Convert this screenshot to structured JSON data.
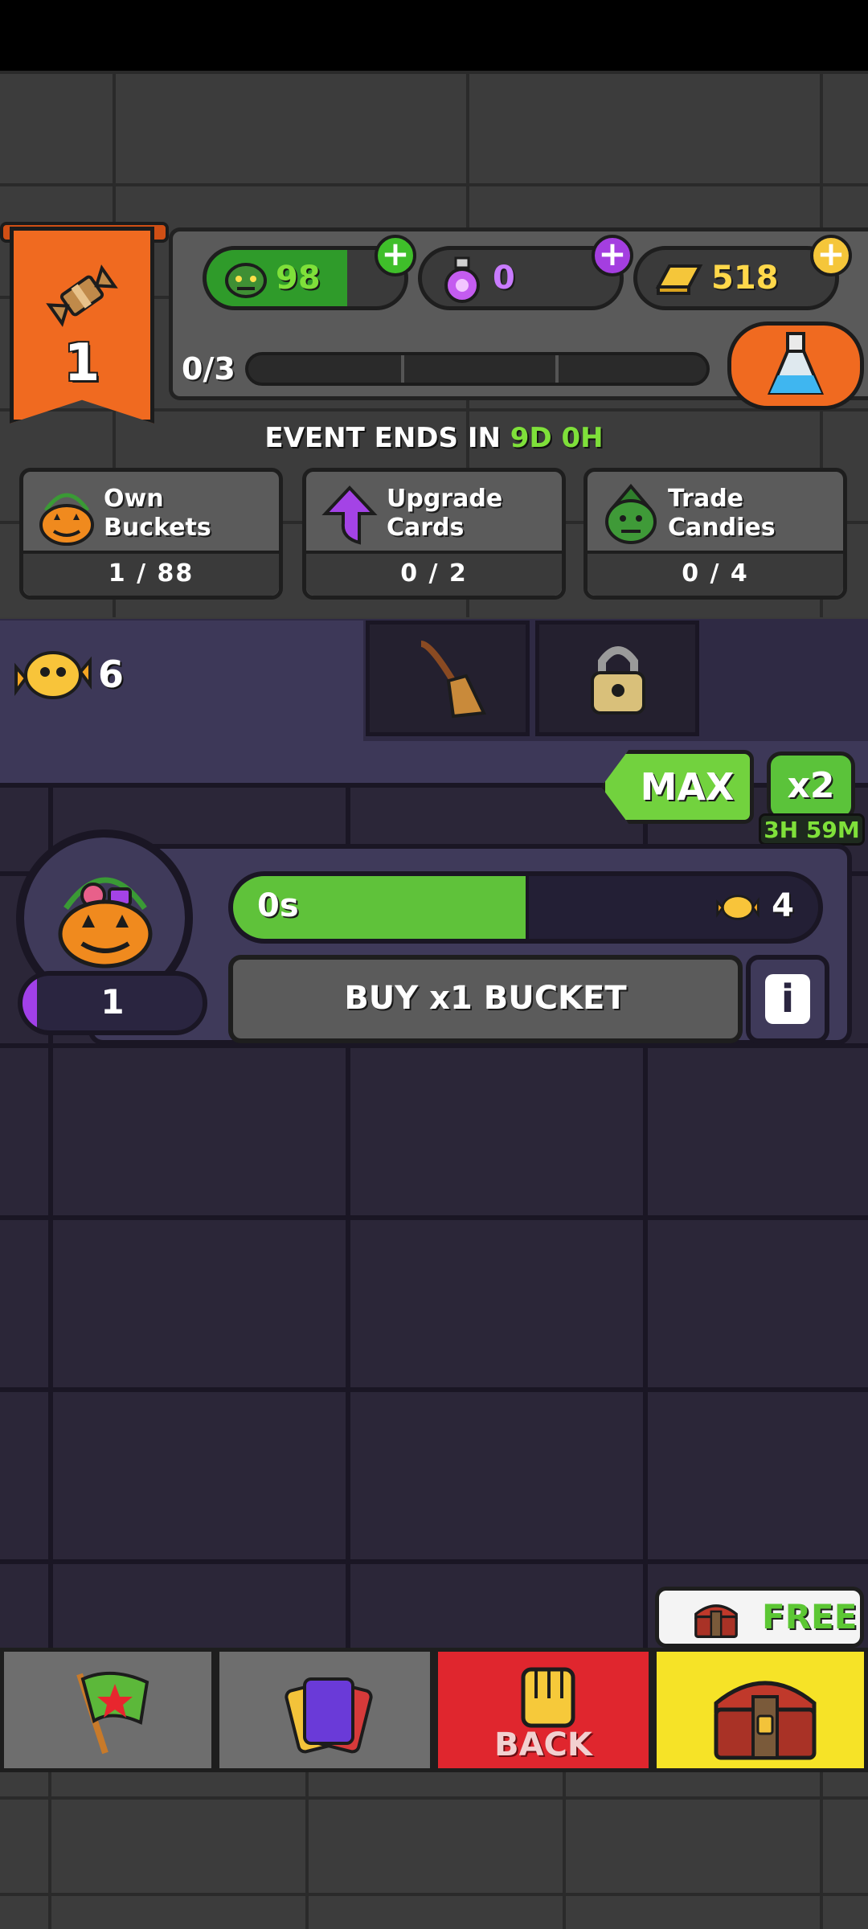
{
  "header": {
    "level": "1",
    "progress_text": "0/3",
    "currencies": [
      {
        "name": "goblin",
        "value": "98",
        "color": "#5bd13a"
      },
      {
        "name": "potion",
        "value": "0",
        "color": "#b05cf0"
      },
      {
        "name": "gold",
        "value": "518",
        "color": "#f5c63a"
      }
    ]
  },
  "event": {
    "label": "EVENT ENDS IN",
    "time": "9D 0H"
  },
  "tasks": [
    {
      "label": "Own Buckets",
      "count": "1 / 88",
      "icon": "pumpkin-bucket-icon"
    },
    {
      "label": "Upgrade\nCards",
      "count": "0 / 2",
      "icon": "purple-arrow-icon"
    },
    {
      "label": "Trade\nCandies",
      "count": "0 / 4",
      "icon": "goblin-head-icon"
    }
  ],
  "tabs": {
    "candy_count": "6"
  },
  "boost": {
    "max_label": "MAX",
    "x2_label": "x2",
    "x2_time": "3H 59M"
  },
  "bucket": {
    "owned": "1",
    "timer": "0s",
    "timer_progress": 0.5,
    "reward": "4",
    "buy_label": "BUY x1 BUCKET",
    "info_label": "i"
  },
  "nav": {
    "back_label": "BACK",
    "free_label": "FREE"
  }
}
